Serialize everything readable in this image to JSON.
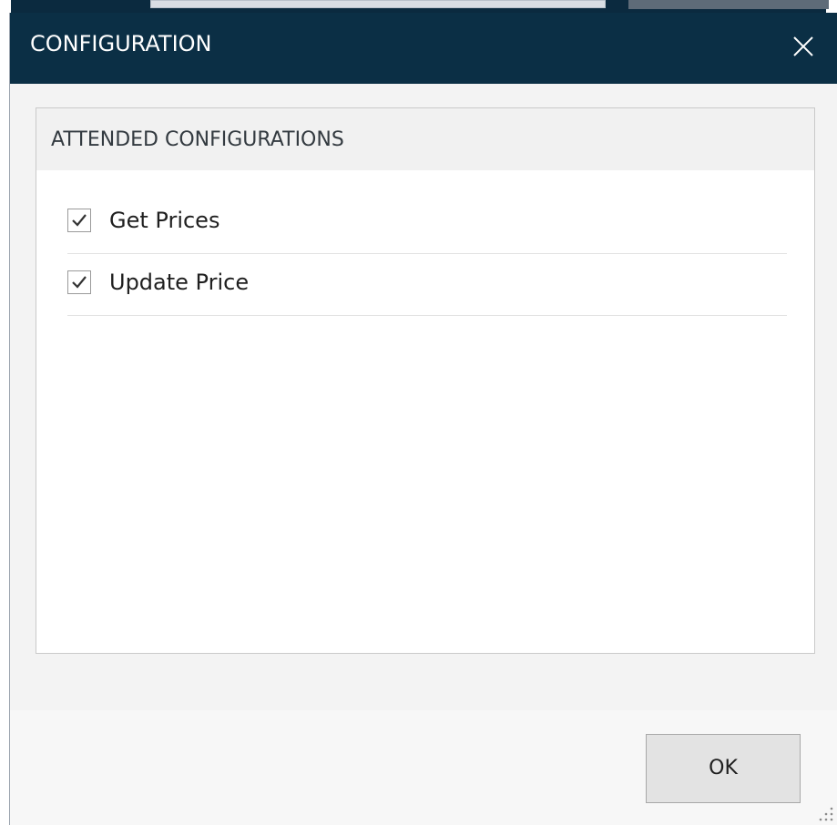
{
  "window": {
    "title": "CONFIGURATION",
    "close_icon": "close-icon"
  },
  "panel": {
    "title": "ATTENDED CONFIGURATIONS",
    "options": [
      {
        "label": "Get Prices",
        "checked": true
      },
      {
        "label": "Update Price",
        "checked": true
      }
    ]
  },
  "footer": {
    "ok_label": "OK"
  },
  "colors": {
    "titlebar": "#0b2f45",
    "title_text": "#ffffff"
  }
}
